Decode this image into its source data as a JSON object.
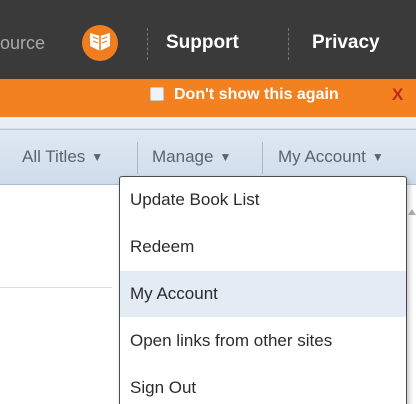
{
  "topbar": {
    "source_text": "ource",
    "support_label": "Support",
    "privacy_label": "Privacy"
  },
  "notice": {
    "dont_show_label": "Don't show this again",
    "close_label": "X",
    "checked": false
  },
  "menubar": {
    "items": [
      {
        "label": "All Titles",
        "arrow": "▼"
      },
      {
        "label": "Manage",
        "arrow": "▼"
      },
      {
        "label": "My Account",
        "arrow": "▼"
      }
    ]
  },
  "dropdown": {
    "items": [
      {
        "label": "Update Book List"
      },
      {
        "label": "Redeem"
      },
      {
        "label": "My Account",
        "highlighted": true
      },
      {
        "label": "Open links from other sites"
      },
      {
        "label": "Sign Out"
      }
    ]
  },
  "colors": {
    "topbar_bg": "#3a3a3a",
    "notice_bg": "#f4811f",
    "logo_orange": "#f07d1e",
    "close_red": "#c0281a",
    "menubar_bg": "#d8e3ee",
    "highlight_bg": "#e3ebf4"
  },
  "icons": {
    "logo": "orange-book-logo-icon",
    "menu_arrow": "caret-down-icon",
    "scroll": "scroll-up-arrow-icon"
  }
}
